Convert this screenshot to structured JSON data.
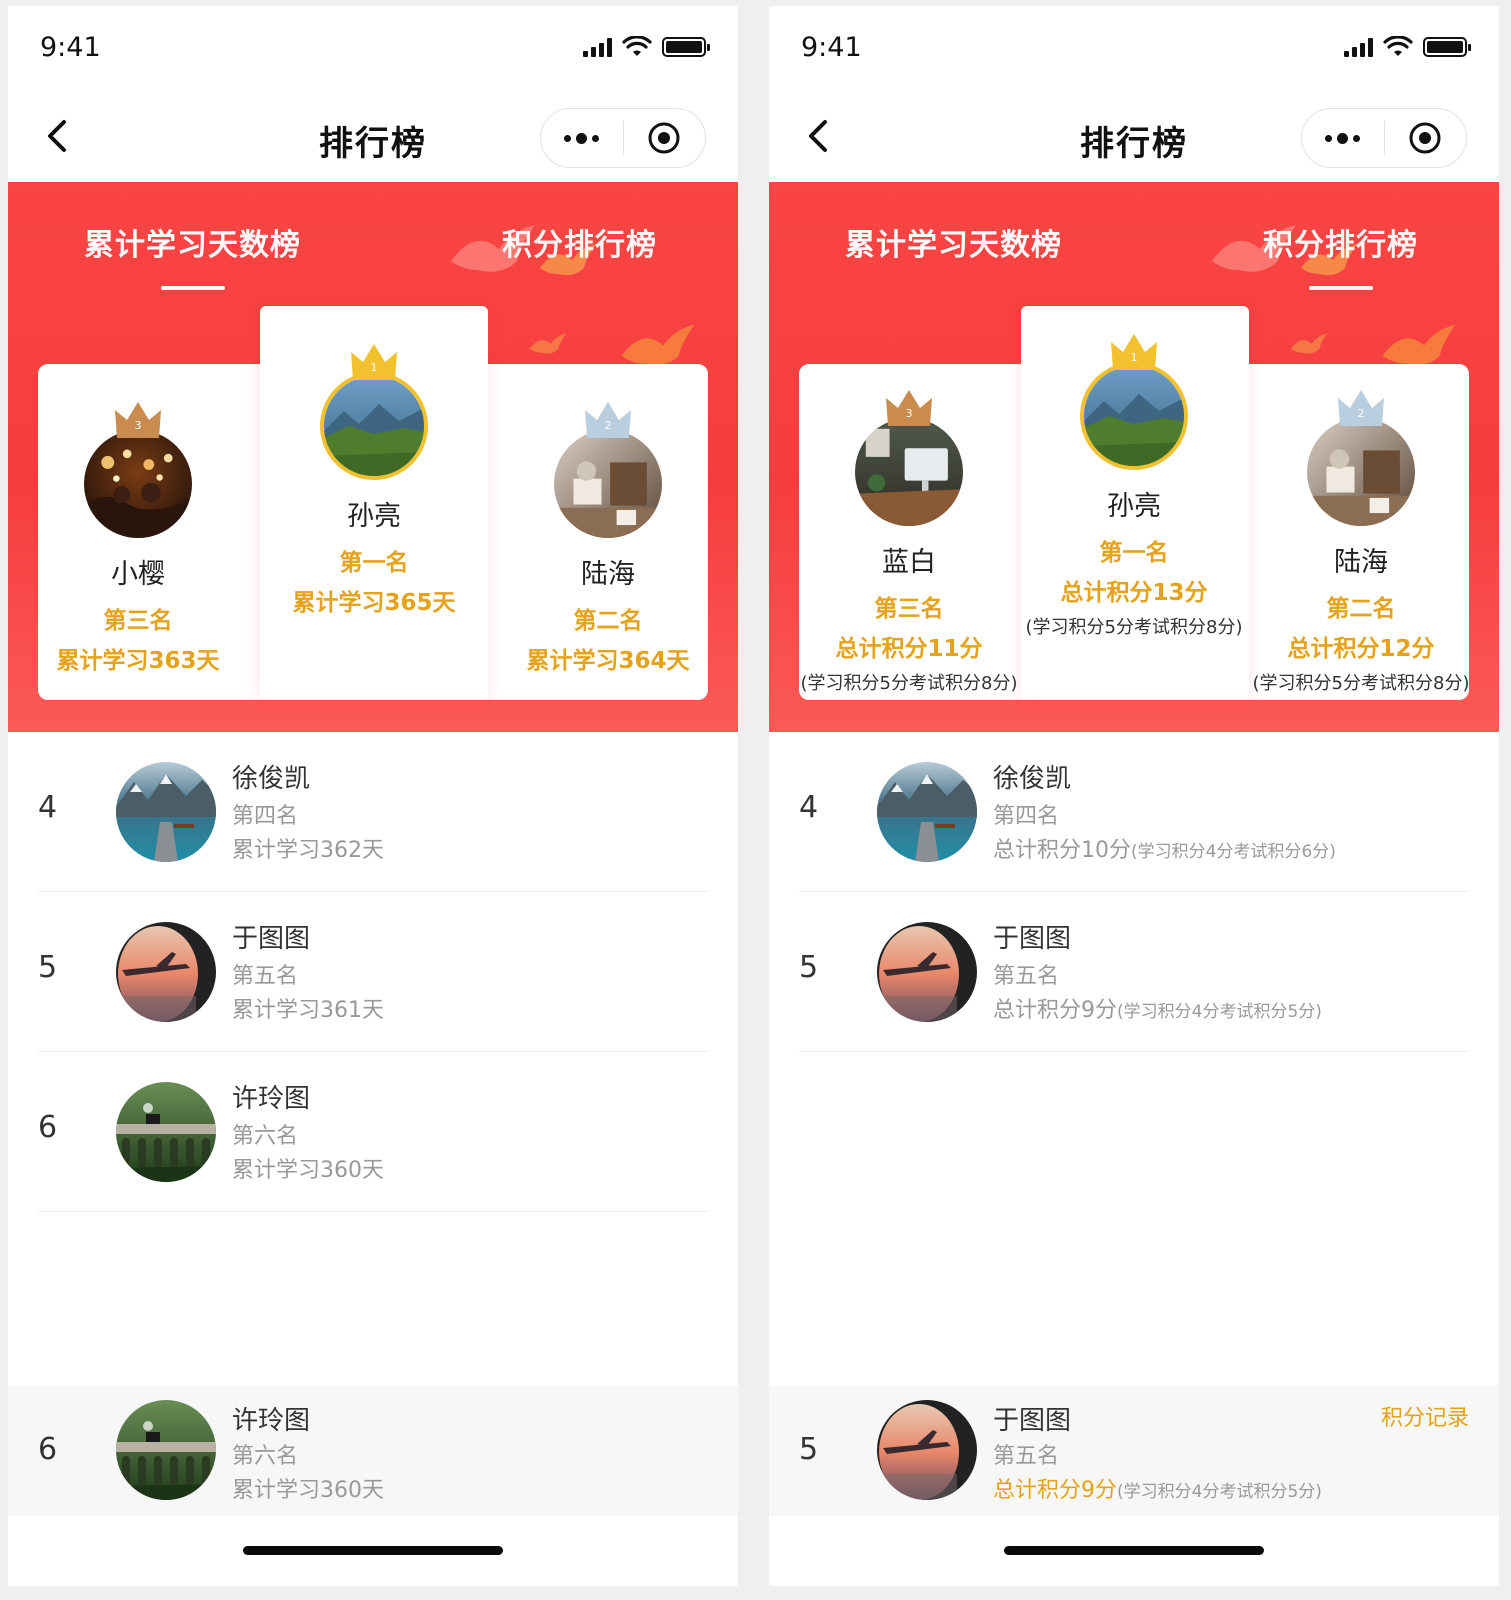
{
  "status": {
    "time": "9:41"
  },
  "nav": {
    "title": "排行榜"
  },
  "tabs": {
    "days": "累计学习天数榜",
    "points": "积分排行榜"
  },
  "screen1": {
    "podium": {
      "first": {
        "name": "孙亮",
        "rank": "第一名",
        "stat": "累计学习365天"
      },
      "second": {
        "name": "陆海",
        "rank": "第二名",
        "stat": "累计学习364天"
      },
      "third": {
        "name": "小樱",
        "rank": "第三名",
        "stat": "累计学习363天"
      }
    },
    "list": [
      {
        "num": "4",
        "name": "徐俊凯",
        "rank": "第四名",
        "stat": "累计学习362天"
      },
      {
        "num": "5",
        "name": "于图图",
        "rank": "第五名",
        "stat": "累计学习361天"
      },
      {
        "num": "6",
        "name": "许玲图",
        "rank": "第六名",
        "stat": "累计学习360天"
      }
    ],
    "mine": {
      "num": "6",
      "name": "许玲图",
      "rank": "第六名",
      "stat": "累计学习360天"
    }
  },
  "screen2": {
    "podium": {
      "first": {
        "name": "孙亮",
        "rank": "第一名",
        "stat": "总计积分13分",
        "sub": "(学习积分5分考试积分8分)"
      },
      "second": {
        "name": "陆海",
        "rank": "第二名",
        "stat": "总计积分12分",
        "sub": "(学习积分5分考试积分8分)"
      },
      "third": {
        "name": "蓝白",
        "rank": "第三名",
        "stat": "总计积分11分",
        "sub": "(学习积分5分考试积分8分)"
      }
    },
    "list": [
      {
        "num": "4",
        "name": "徐俊凯",
        "rank": "第四名",
        "stat": "总计积分10分",
        "sub": "(学习积分4分考试积分6分)"
      },
      {
        "num": "5",
        "name": "于图图",
        "rank": "第五名",
        "stat": "总计积分9分",
        "sub": "(学习积分4分考试积分5分)"
      }
    ],
    "mine": {
      "num": "5",
      "name": "于图图",
      "rank": "第五名",
      "stat": "总计积分9分",
      "sub": "(学习积分4分考试积分5分)",
      "link": "积分记录"
    }
  },
  "crowns": {
    "first": "1",
    "second": "2",
    "third": "3"
  },
  "colors": {
    "header_red": "#f53d3d",
    "gold_text": "#e5a21b",
    "crown_gold": "#f2c12e",
    "crown_silver": "#b9cfe0",
    "crown_bronze": "#c98b4e"
  }
}
